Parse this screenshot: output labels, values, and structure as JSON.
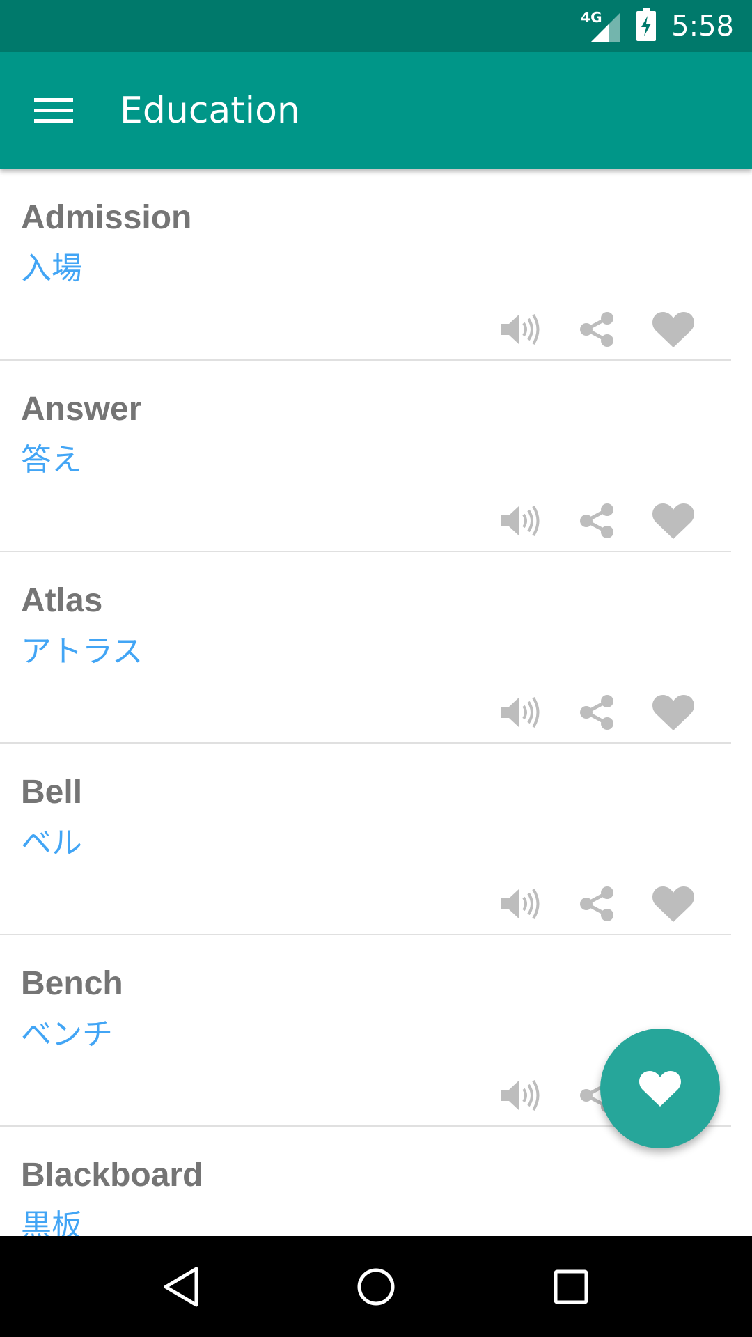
{
  "status_bar": {
    "network": "4G",
    "time": "5:58"
  },
  "app_bar": {
    "title": "Education",
    "menu_icon": "hamburger-menu-icon"
  },
  "words": [
    {
      "english": "Admission",
      "japanese": "入場"
    },
    {
      "english": "Answer",
      "japanese": "答え"
    },
    {
      "english": "Atlas",
      "japanese": "アトラス"
    },
    {
      "english": "Bell",
      "japanese": "ベル"
    },
    {
      "english": "Bench",
      "japanese": "ベンチ"
    },
    {
      "english": "Blackboard",
      "japanese": "黒板"
    }
  ],
  "card_action_icons": [
    "speaker-icon",
    "share-icon",
    "heart-icon"
  ],
  "fab": {
    "icon": "heart-icon"
  },
  "colors": {
    "status_bar": "#00796b",
    "app_bar": "#009688",
    "fab": "#26a69a",
    "english_text": "#757575",
    "japanese_text": "#42a5f5",
    "action_icon": "#bdbdbd",
    "nav_bar": "#000000"
  },
  "nav_bar": {
    "back_icon": "back-triangle-icon",
    "home_icon": "home-circle-icon",
    "recents_icon": "recents-square-icon"
  }
}
